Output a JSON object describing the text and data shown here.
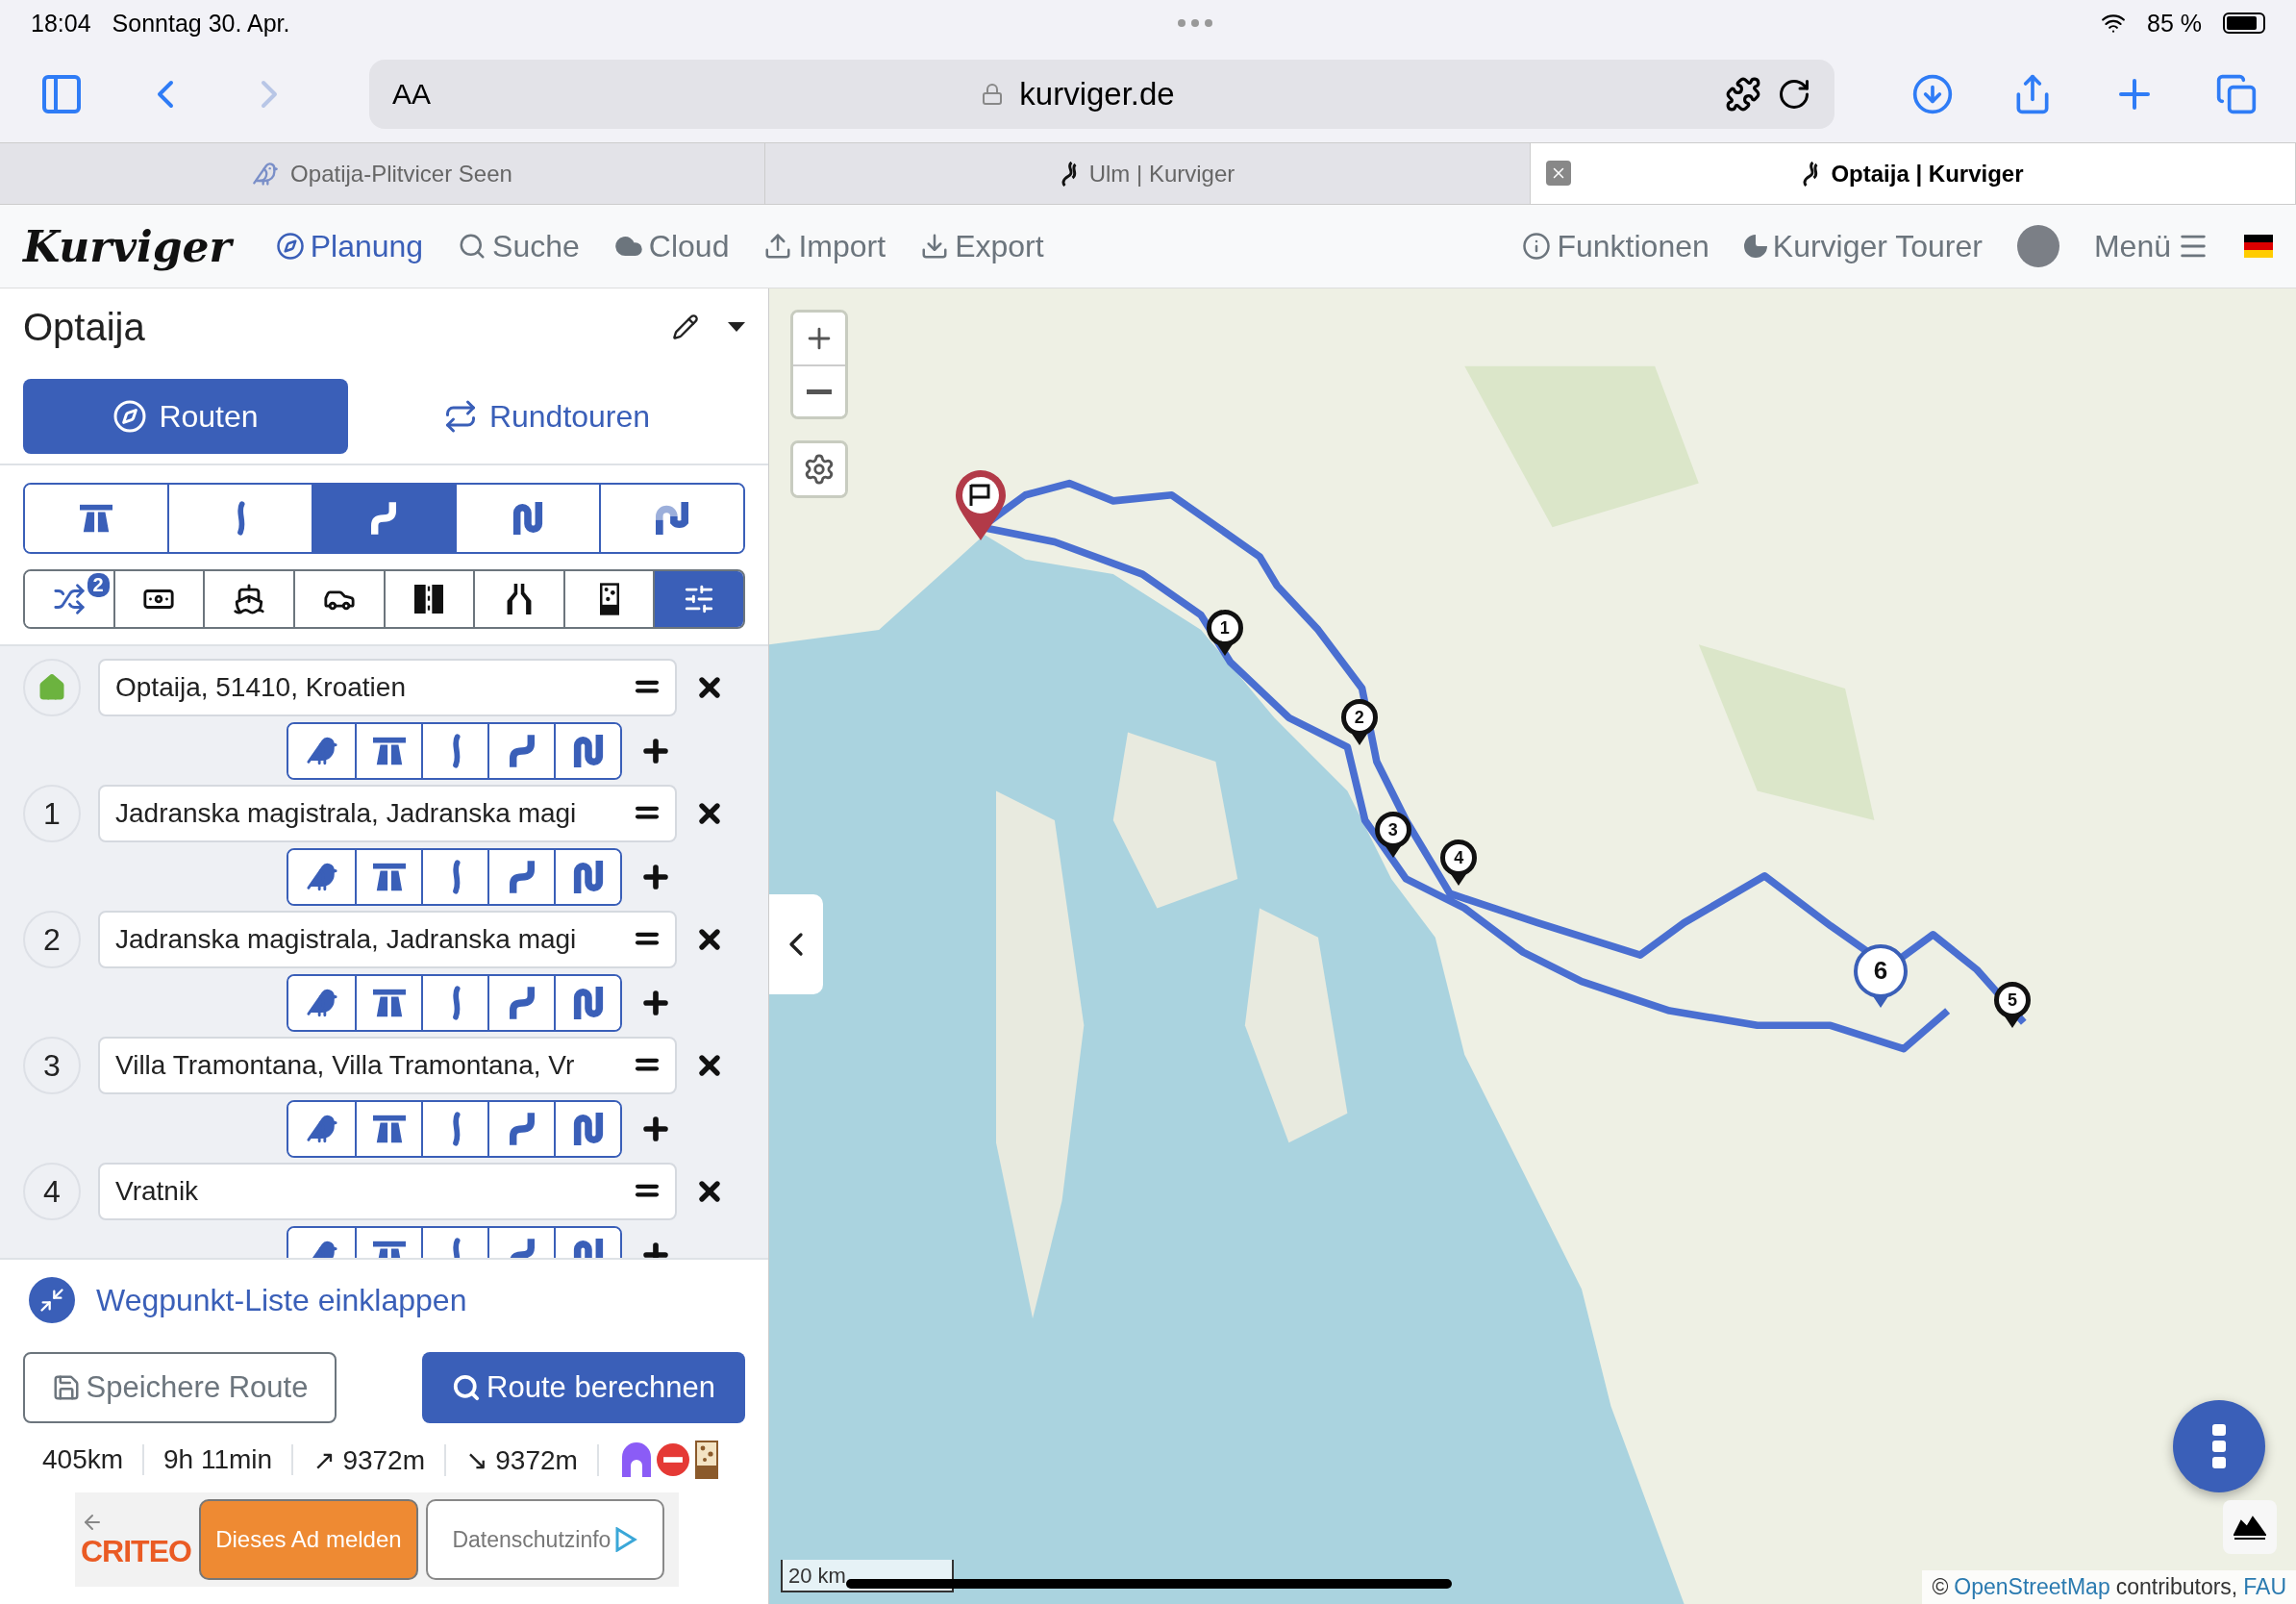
{
  "status_bar": {
    "time": "18:04",
    "date": "Sonntag 30. Apr.",
    "battery": "85 %"
  },
  "browser": {
    "text_size": "AA",
    "url": "kurviger.de",
    "tabs": [
      {
        "title": "Opatija-Plitvicer Seen",
        "selected": false
      },
      {
        "title": "Ulm | Kurviger",
        "selected": false
      },
      {
        "title": "Optaija | Kurviger",
        "selected": true
      }
    ]
  },
  "nav": {
    "logo": "Kurviger",
    "items": [
      {
        "label": "Planung",
        "selected": true
      },
      {
        "label": "Suche",
        "selected": false
      },
      {
        "label": "Cloud",
        "selected": false
      },
      {
        "label": "Import",
        "selected": false
      },
      {
        "label": "Export",
        "selected": false
      }
    ],
    "right_items": [
      "Funktionen",
      "Kurviger Tourer"
    ],
    "menu": "Menü"
  },
  "sidebar": {
    "route_title": "Optaija",
    "mode_tabs": [
      {
        "label": "Routen",
        "selected": true
      },
      {
        "label": "Rundtouren",
        "selected": false
      }
    ],
    "profiles": [
      {
        "selected": false
      },
      {
        "selected": false
      },
      {
        "selected": true
      },
      {
        "selected": false
      },
      {
        "selected": false
      }
    ],
    "options": [
      {
        "selected": false,
        "badge": "2"
      },
      {
        "selected": false
      },
      {
        "selected": false
      },
      {
        "selected": false
      },
      {
        "selected": false
      },
      {
        "selected": false
      },
      {
        "selected": false
      },
      {
        "selected": true
      }
    ],
    "waypoints": [
      {
        "kind": "start",
        "value": "Optaija, 51410, Kroatien"
      },
      {
        "kind": "stop",
        "label": "1",
        "value": "Jadranska magistrala, Jadranska magi"
      },
      {
        "kind": "stop",
        "label": "2",
        "value": "Jadranska magistrala, Jadranska magi"
      },
      {
        "kind": "stop",
        "label": "3",
        "value": "Villa Tramontana, Villa Tramontana, Vr"
      },
      {
        "kind": "stop",
        "label": "4",
        "value": "Vratnik"
      }
    ],
    "collapse_link": "Wegpunkt-Liste einklappen",
    "save_button": "Speichere Route",
    "calculate_button": "Route berechnen",
    "stats": [
      "405km",
      "9h 11min",
      "↗ 9372m",
      "↘ 9372m"
    ],
    "ad": {
      "logo": "CRITEO",
      "report_button": "Dieses Ad melden",
      "privacy_button": "Datenschutzinfo"
    }
  },
  "map": {
    "markers": [
      {
        "label": "1",
        "highlighted": false
      },
      {
        "label": "2",
        "highlighted": false
      },
      {
        "label": "3",
        "highlighted": false
      },
      {
        "label": "4",
        "highlighted": false
      },
      {
        "label": "6",
        "highlighted": true
      },
      {
        "label": "5",
        "highlighted": false
      }
    ],
    "scale": "20 km",
    "attribution": {
      "copyright": "©",
      "osm_link": "OpenStreetMap",
      "text": "contributors,",
      "fau_link": "FAU"
    }
  }
}
